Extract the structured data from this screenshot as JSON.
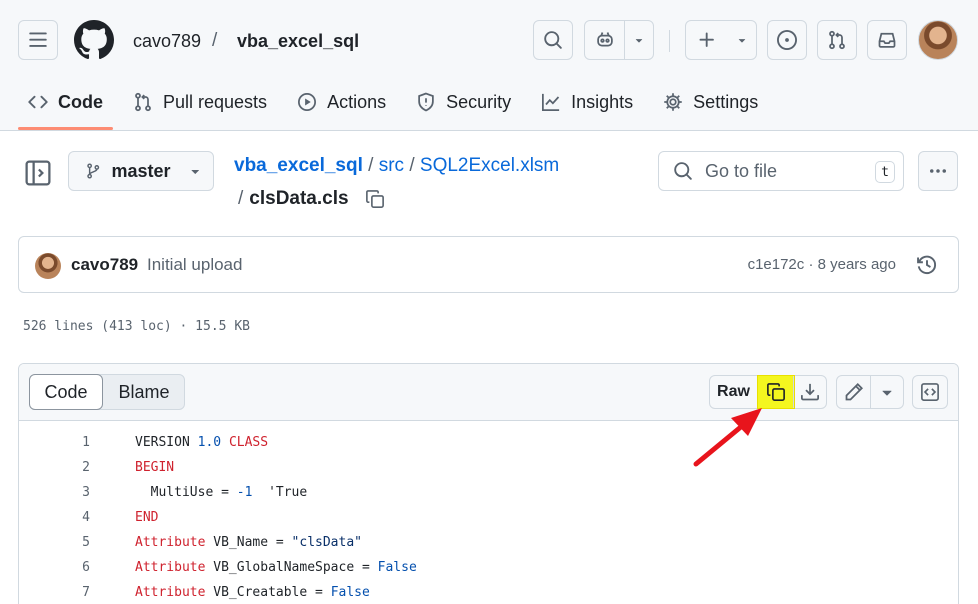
{
  "header": {
    "owner": "cavo789",
    "separator": "/",
    "repo": "vba_excel_sql",
    "icons": [
      "menu-icon",
      "github-logo",
      "search-icon",
      "copilot-icon",
      "plus-icon",
      "issues-icon",
      "pull-requests-icon",
      "inbox-icon"
    ]
  },
  "tabs": [
    {
      "label": "Code",
      "icon": "code-icon",
      "active": true
    },
    {
      "label": "Pull requests",
      "icon": "git-pull-request-icon"
    },
    {
      "label": "Actions",
      "icon": "play-icon"
    },
    {
      "label": "Security",
      "icon": "shield-icon"
    },
    {
      "label": "Insights",
      "icon": "graph-icon"
    },
    {
      "label": "Settings",
      "icon": "gear-icon"
    }
  ],
  "file_nav": {
    "branch": "master",
    "breadcrumb": {
      "repo": "vba_excel_sql",
      "sep1": "/",
      "folder": "src",
      "sep2": "/",
      "workbook": "SQL2Excel.xlsm",
      "sep3": "/",
      "file": "clsData.cls"
    },
    "goto_placeholder": "Go to file",
    "goto_shortcut": "t"
  },
  "commit": {
    "author": "cavo789",
    "message": "Initial upload",
    "meta": "c1e172c · 8 years ago"
  },
  "file_info": "526 lines (413 loc) · 15.5 KB",
  "viewer": {
    "tab_code": "Code",
    "tab_blame": "Blame",
    "raw_label": "Raw",
    "highlight_color": "#f4f61f",
    "arrow_color": "#e8141c"
  },
  "code_lines": [
    {
      "n": "1"
    },
    {
      "n": "2"
    },
    {
      "n": "3"
    },
    {
      "n": "4"
    },
    {
      "n": "5"
    },
    {
      "n": "6"
    },
    {
      "n": "7"
    }
  ],
  "code_tokens": {
    "l1_a": "VERSION ",
    "l1_b": "1.0",
    "l1_c": " ",
    "l1_d": "CLASS",
    "l2": "BEGIN",
    "l3_a": "  MultiUse = ",
    "l3_b": "-1",
    "l3_c": "  ",
    "l3_d": "'True",
    "l4": "END",
    "l5_a": "Attribute",
    "l5_b": " VB_Name = ",
    "l5_c": "\"clsData\"",
    "l6_a": "Attribute",
    "l6_b": " VB_GlobalNameSpace = ",
    "l6_c": "False",
    "l7_a": "Attribute",
    "l7_b": " VB_Creatable = ",
    "l7_c": "False"
  }
}
